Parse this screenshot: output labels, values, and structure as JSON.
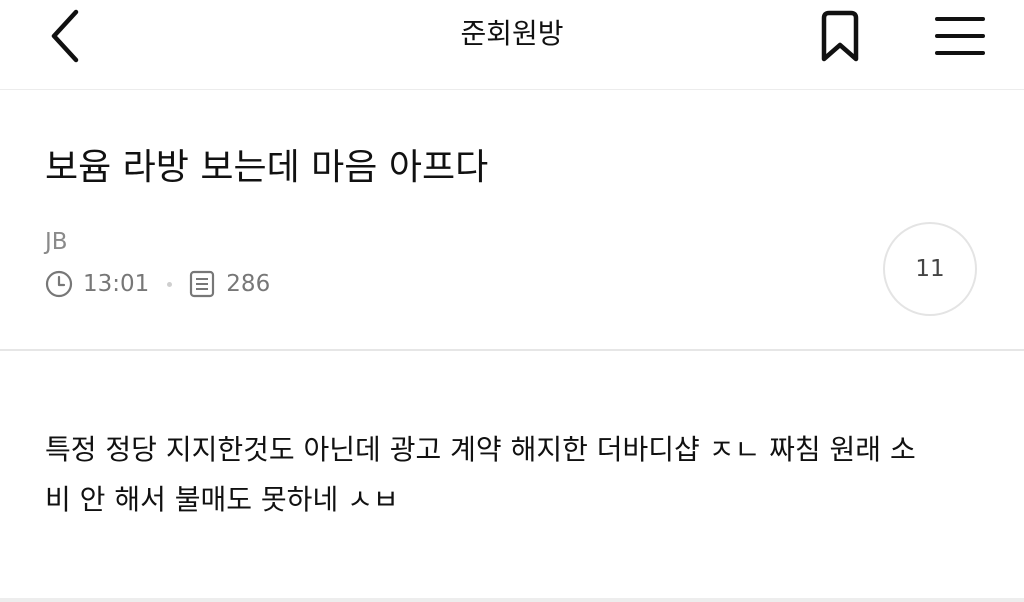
{
  "header": {
    "back_icon": "chevron-left-icon",
    "title": "준회원방",
    "bookmark_icon": "bookmark-icon",
    "menu_icon": "hamburger-menu-icon"
  },
  "post": {
    "title": "보윰 라방 보는데 마음 아프다",
    "author": "JB",
    "time_icon": "clock-icon",
    "time": "13:01",
    "views_icon": "document-icon",
    "views": "286",
    "comment_count": "11",
    "body_lines": [
      "특정 정당 지지한것도 아닌데 광고 계약 해지한 더바디샵 ㅈㄴ 짜침 원래 소",
      "비 안 해서 불매도 못하네 ㅅㅂ"
    ]
  }
}
